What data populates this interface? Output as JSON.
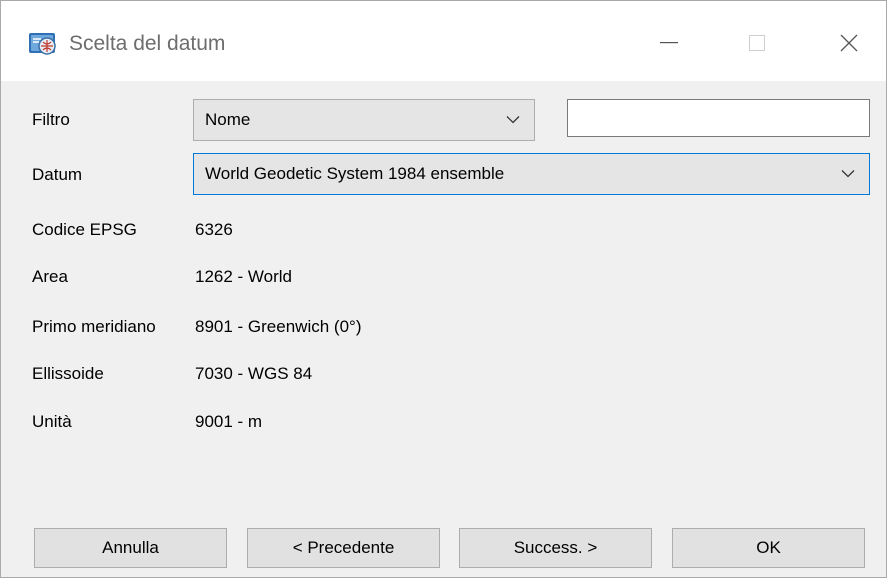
{
  "window": {
    "title": "Scelta del datum",
    "icon": "datum-app-icon"
  },
  "form": {
    "filter": {
      "label": "Filtro",
      "selected": "Nome",
      "text_value": ""
    },
    "datum": {
      "label": "Datum",
      "selected": "World Geodetic System 1984 ensemble"
    },
    "epsg_code": {
      "label": "Codice EPSG",
      "value": "6326"
    },
    "area": {
      "label": "Area",
      "value": "1262 - World"
    },
    "prime_meridian": {
      "label": "Primo meridiano",
      "value": "8901 - Greenwich (0°)"
    },
    "ellipsoid": {
      "label": "Ellissoide",
      "value": "7030 - WGS 84"
    },
    "unit": {
      "label": "Unità",
      "value": "9001 - m"
    }
  },
  "buttons": {
    "cancel": "Annulla",
    "previous": "< Precedente",
    "next": "Success. >",
    "ok": "OK"
  },
  "colors": {
    "focus_border": "#0078d7",
    "button_face": "#e1e1e1",
    "dialog_bg": "#f0f0f0"
  }
}
